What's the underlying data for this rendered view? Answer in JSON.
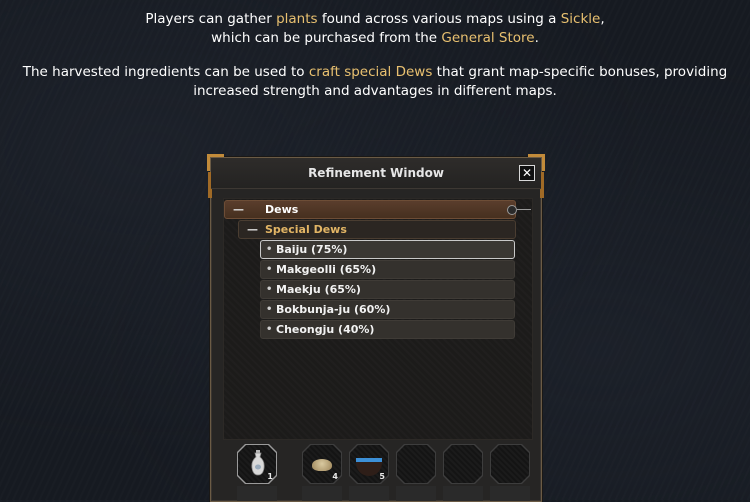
{
  "intro": {
    "p1": {
      "line1_a": "Players can gather ",
      "line1_plants": "plants",
      "line1_b": " found across various maps using a ",
      "line1_sickle": "Sickle",
      "line1_c": ",",
      "line2_a": "which can be purchased from the ",
      "line2_store": "General Store",
      "line2_b": "."
    },
    "p2": {
      "line1_a": "The harvested ingredients can be used to ",
      "line1_craft": "craft special Dews",
      "line1_b": " that grant map-specific bonuses, providing",
      "line2": "increased strength and advantages in different maps."
    },
    "highlight_color": "#e8c070"
  },
  "window": {
    "title": "Refinement Window",
    "close_glyph": "✕",
    "tree": {
      "category": {
        "sign": "—",
        "label": "Dews"
      },
      "subcategory": {
        "sign": "—",
        "label": "Special Dews"
      },
      "items": [
        {
          "label": "Baiju (75%)",
          "selected": true
        },
        {
          "label": "Makgeolli (65%)",
          "selected": false
        },
        {
          "label": "Maekju (65%)",
          "selected": false
        },
        {
          "label": "Bokbunja-ju (60%)",
          "selected": false
        },
        {
          "label": "Cheongju (40%)",
          "selected": false
        }
      ]
    },
    "inventory": [
      {
        "icon": "vase-icon",
        "qty": "1"
      },
      {
        "icon": "grain-pile-icon",
        "qty": "4"
      },
      {
        "icon": "water-bowl-icon",
        "qty": "5"
      },
      {
        "icon": "",
        "qty": ""
      },
      {
        "icon": "",
        "qty": ""
      },
      {
        "icon": "",
        "qty": ""
      }
    ]
  }
}
